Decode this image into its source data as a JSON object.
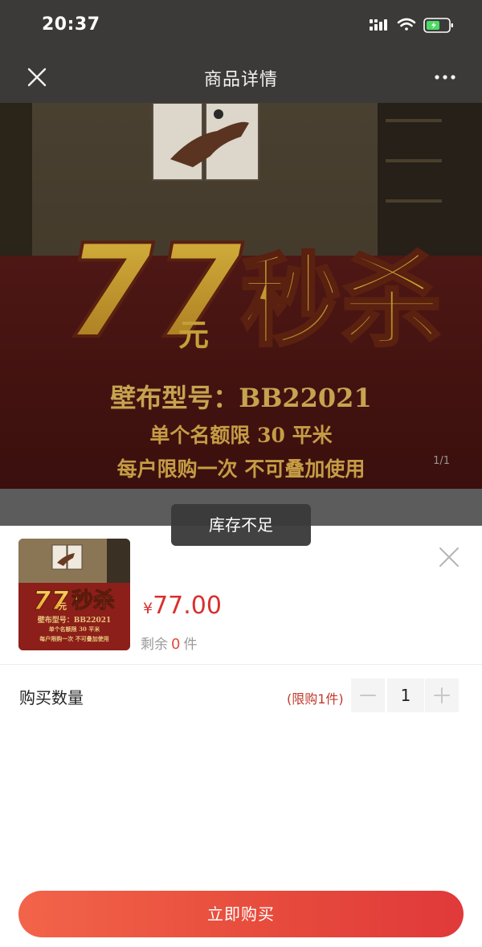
{
  "status_bar": {
    "time": "20:37"
  },
  "nav": {
    "title": "商品详情"
  },
  "banner": {
    "headline_number": "77",
    "headline_unit": "元",
    "headline_word": "秒杀",
    "model_line": "壁布型号：BB22021",
    "limit_line": "单个名额限 30 平米",
    "once_line": "每户限购一次 不可叠加使用",
    "counter": "1/1"
  },
  "toast": {
    "message": "库存不足"
  },
  "sheet": {
    "price_symbol": "¥",
    "price": "77.00",
    "stock_prefix": "剩余",
    "stock_count": "0",
    "stock_unit": "件",
    "quantity_label": "购买数量",
    "purchase_limit": "(限购1件)",
    "quantity": "1",
    "buy_label": "立即购买"
  },
  "colors": {
    "price_red": "#d8302e",
    "buy_gradient_start": "#f2644a",
    "buy_gradient_end": "#e0393a",
    "overlay_gray": "#3b3a38",
    "battery_green": "#4cd964"
  }
}
